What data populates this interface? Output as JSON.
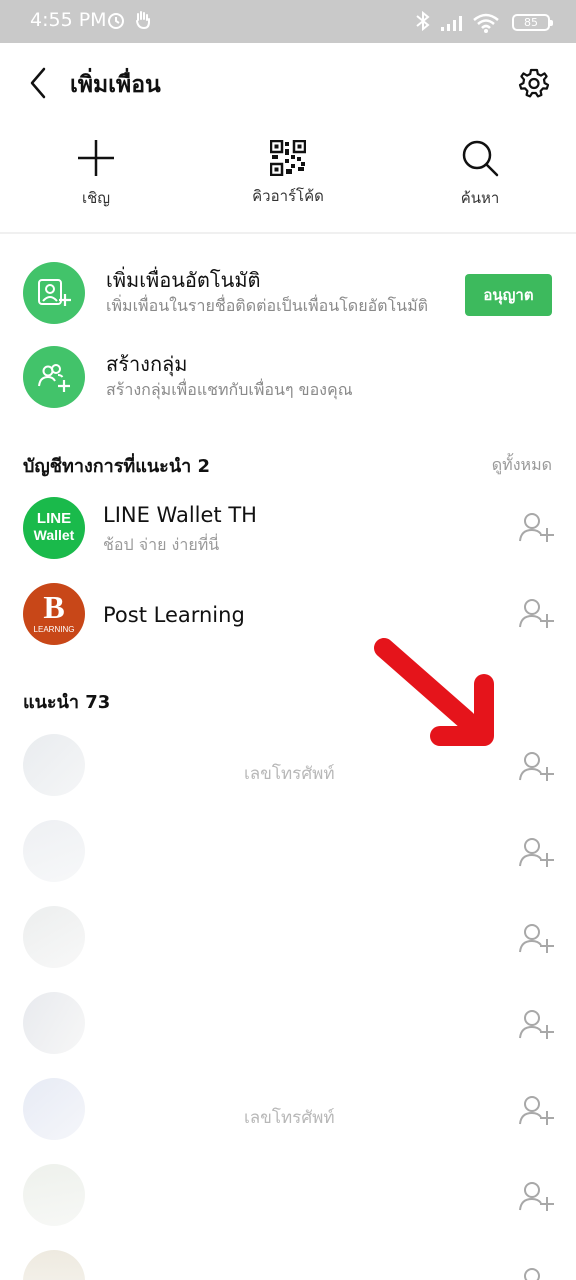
{
  "status_bar": {
    "time": "4:55 PM",
    "battery": "85"
  },
  "header": {
    "title": "เพิ่มเพื่อน"
  },
  "actions": [
    {
      "label": "เชิญ",
      "icon": "plus-icon"
    },
    {
      "label": "คิวอาร์โค้ด",
      "icon": "qr-code-icon"
    },
    {
      "label": "ค้นหา",
      "icon": "search-icon"
    }
  ],
  "auto_add": {
    "title": "เพิ่มเพื่อนอัตโนมัติ",
    "subtitle": "เพิ่มเพื่อนในรายชื่อติดต่อเป็นเพื่อนโดยอัตโนมัติ",
    "button": "อนุญาต"
  },
  "create_group": {
    "title": "สร้างกลุ่ม",
    "subtitle": "สร้างกลุ่มเพื่อแชทกับเพื่อนๆ ของคุณ"
  },
  "official": {
    "title": "บัญชีทางการที่แนะนำ 2",
    "see_all": "ดูทั้งหมด",
    "accounts": [
      {
        "name": "LINE Wallet TH",
        "subtitle": "ช้อป จ่าย ง่ายที่นี่",
        "logo_line1": "LINE",
        "logo_line2": "Wallet"
      },
      {
        "name": "Post Learning",
        "subtitle": "",
        "logo_letter": "B",
        "logo_text": "LEARNING"
      }
    ]
  },
  "suggested": {
    "title": "แนะนำ 73",
    "items": [
      {
        "text": "เลขโทรศัพท์"
      },
      {
        "text": ""
      },
      {
        "text": ""
      },
      {
        "text": ""
      },
      {
        "text": "เลขโทรศัพท์"
      },
      {
        "text": ""
      },
      {
        "text": ""
      }
    ]
  },
  "colors": {
    "line_green": "#42c36a",
    "allow_button": "#3dba5d",
    "annotation_arrow": "#e5141b"
  }
}
